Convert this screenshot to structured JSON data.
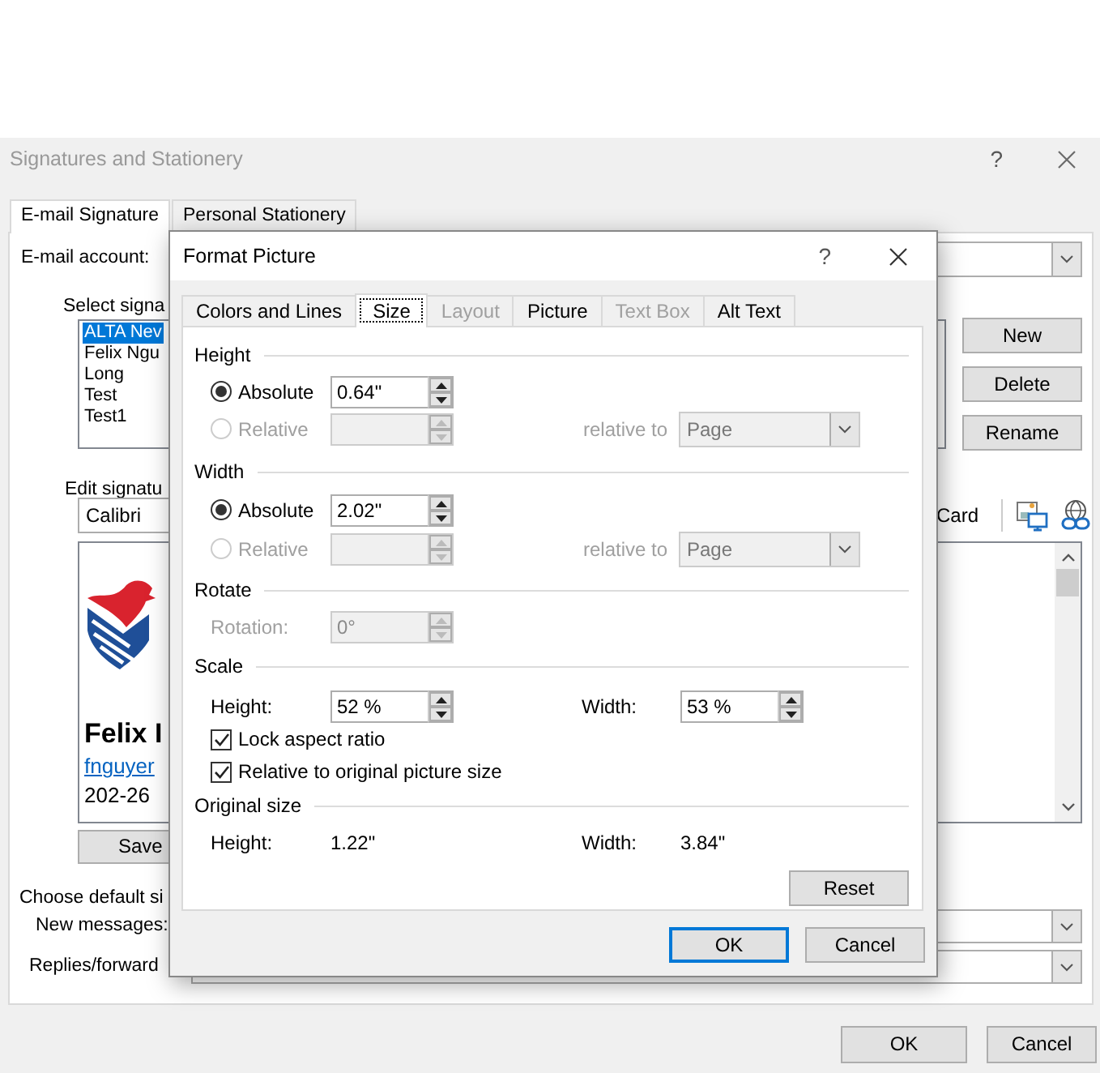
{
  "main_window": {
    "title": "Signatures and Stationery",
    "help": "?",
    "tabs": [
      {
        "label": "E-mail Signature",
        "selected": true
      },
      {
        "label": "Personal Stationery",
        "selected": false
      }
    ],
    "email_account_label": "E-mail account:",
    "select_signature_label": "Select signa",
    "signatures": [
      {
        "label": "ALTA Nev",
        "selected": true
      },
      {
        "label": "Felix Ngu",
        "selected": false
      },
      {
        "label": "Long",
        "selected": false
      },
      {
        "label": "Test",
        "selected": false
      },
      {
        "label": "Test1",
        "selected": false
      }
    ],
    "signature_buttons": [
      "New",
      "Delete",
      "Rename"
    ],
    "edit_signature_label": "Edit signatu",
    "font": "Calibri",
    "card_button": "Card",
    "signature_preview": {
      "name": "Felix I",
      "email": "fnguyer",
      "phone": "202-26"
    },
    "save_button": "Save",
    "default_signature_label": "Choose default si",
    "new_messages_label": "New messages:",
    "replies_label": "Replies/forward",
    "buttons": [
      "OK",
      "Cancel"
    ]
  },
  "dialog": {
    "title": "Format Picture",
    "help": "?",
    "tabs": [
      {
        "label": "Colors and Lines",
        "selected": false,
        "disabled": false
      },
      {
        "label": "Size",
        "selected": true,
        "disabled": false
      },
      {
        "label": "Layout",
        "selected": false,
        "disabled": true
      },
      {
        "label": "Picture",
        "selected": false,
        "disabled": false
      },
      {
        "label": "Text Box",
        "selected": false,
        "disabled": true
      },
      {
        "label": "Alt Text",
        "selected": false,
        "disabled": false
      }
    ],
    "sections": [
      {
        "title": "Height",
        "rows": [
          {
            "kind": "radio",
            "label": "Absolute",
            "selected": true,
            "disabled": false,
            "value": "0.64\""
          },
          {
            "kind": "radio",
            "label": "Relative",
            "selected": false,
            "disabled": true,
            "relative_label": "relative to",
            "relative_value": "Page"
          }
        ]
      },
      {
        "title": "Width",
        "rows": [
          {
            "kind": "radio",
            "label": "Absolute",
            "selected": true,
            "disabled": false,
            "value": "2.02\""
          },
          {
            "kind": "radio",
            "label": "Relative",
            "selected": false,
            "disabled": true,
            "relative_label": "relative to",
            "relative_value": "Page"
          }
        ]
      },
      {
        "title": "Rotate",
        "rows": [
          {
            "kind": "spin",
            "label": "Rotation:",
            "value": "0°",
            "disabled": true
          }
        ]
      },
      {
        "title": "Scale",
        "rows": [
          {
            "kind": "pair",
            "label": "Height:",
            "value": "52 %",
            "label2": "Width:",
            "value2": "53 %"
          },
          {
            "kind": "checkbox",
            "label": "Lock aspect ratio",
            "checked": true
          },
          {
            "kind": "checkbox",
            "label": "Relative to original picture size",
            "checked": true
          }
        ]
      },
      {
        "title": "Original size",
        "rows": [
          {
            "kind": "info",
            "label": "Height:",
            "value": "1.22\"",
            "label2": "Width:",
            "value2": "3.84\""
          }
        ]
      }
    ],
    "reset_button": "Reset",
    "buttons": [
      {
        "label": "OK",
        "default": true
      },
      {
        "label": "Cancel",
        "default": false
      }
    ]
  }
}
